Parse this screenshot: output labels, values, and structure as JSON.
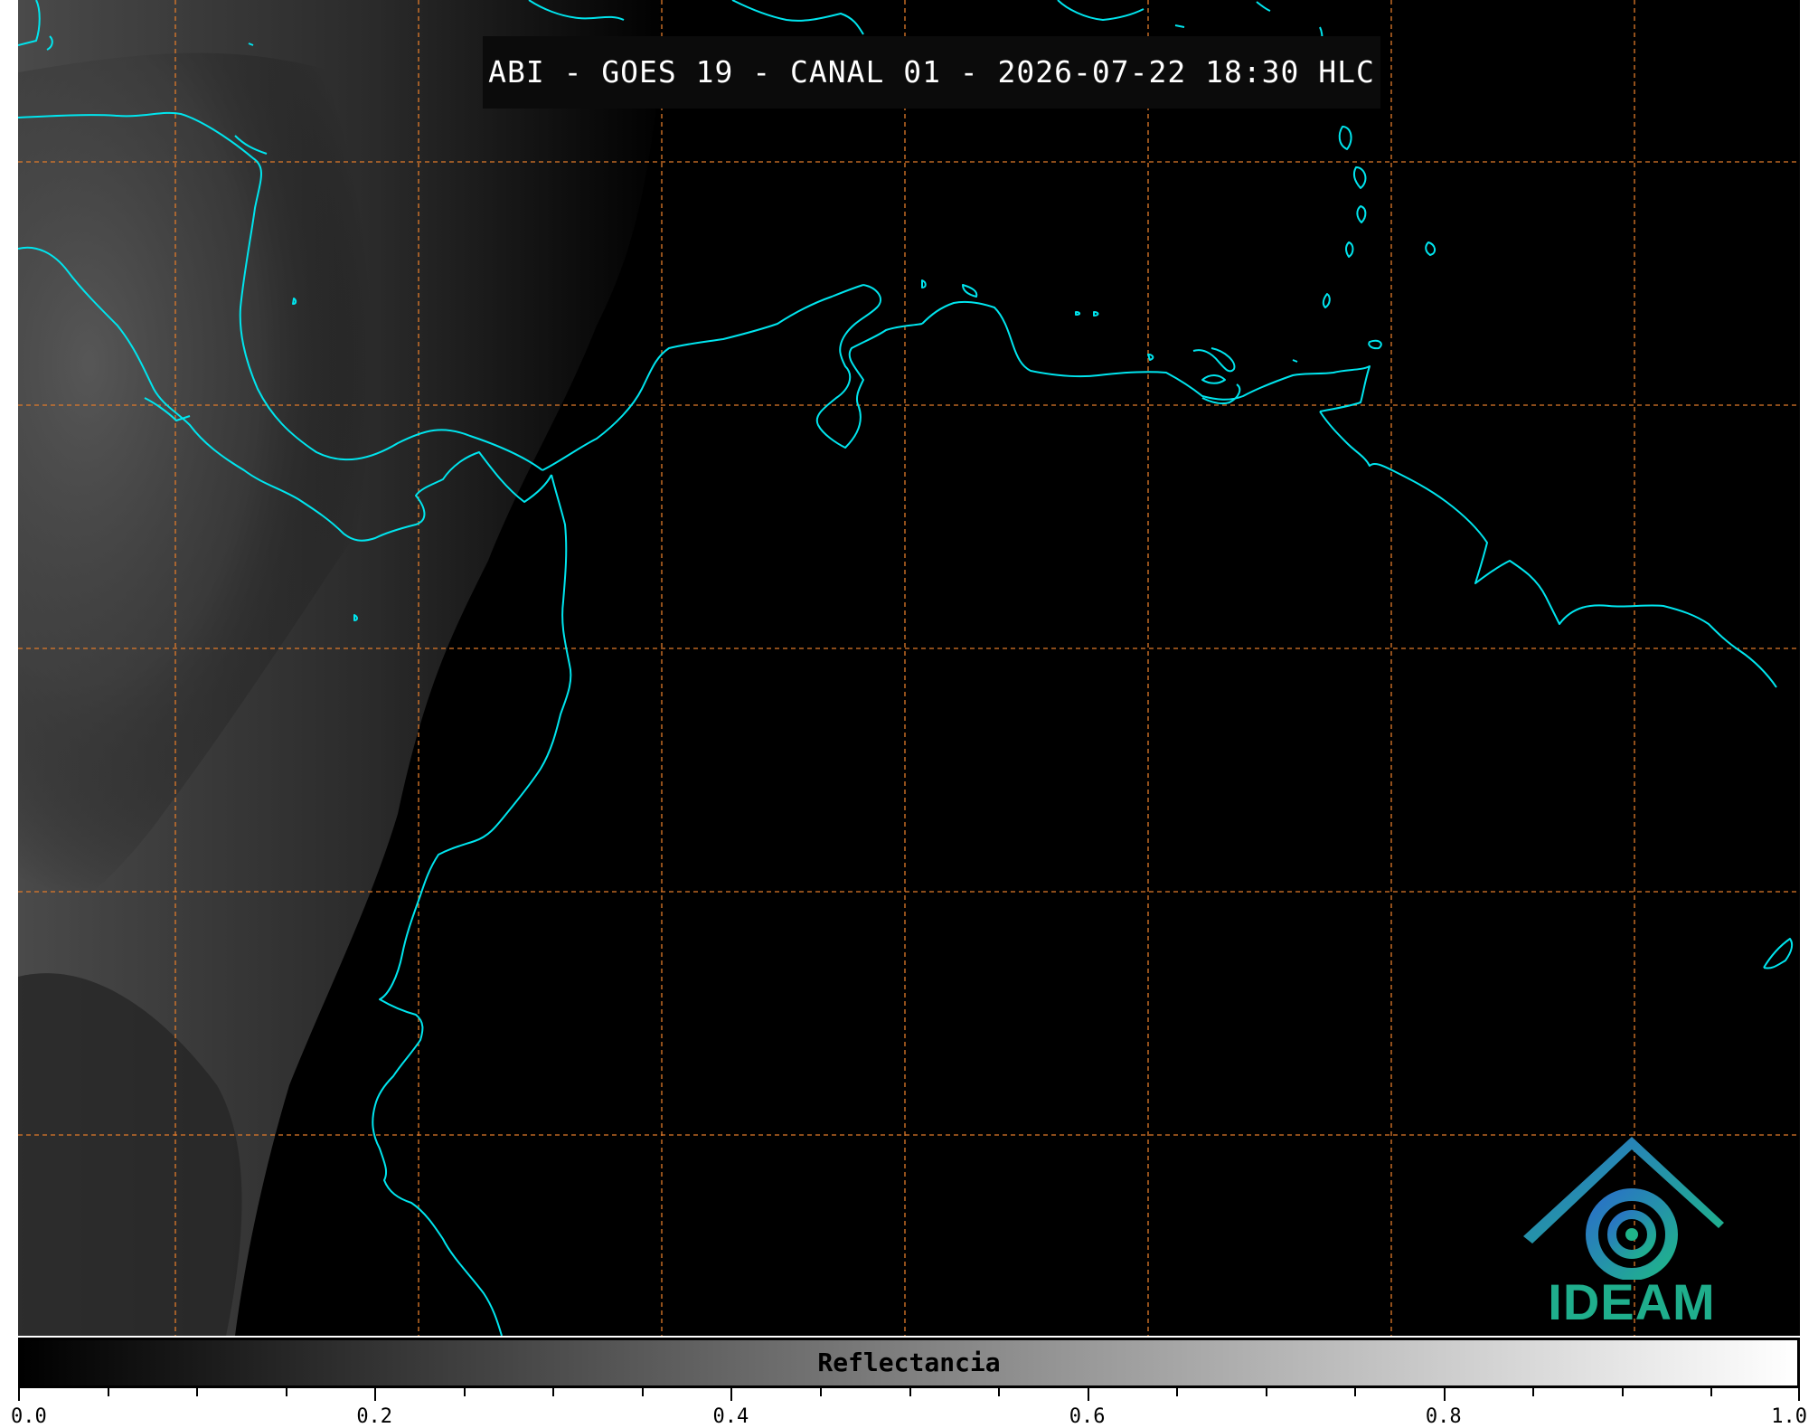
{
  "map": {
    "title": "ABI - GOES 19 - CANAL 01 - 2026-07-22 18:30 HLC",
    "colors": {
      "background": "#000000",
      "coastline": "#00e5ee",
      "grid": "#e07a2a"
    },
    "grid": "on",
    "logo": {
      "text": "IDEAM",
      "icon": "ideam-logo-icon"
    }
  },
  "colorbar": {
    "label": "Reflectancia",
    "range": [
      0.0,
      1.0
    ],
    "ticks": [
      "0.0",
      "0.2",
      "0.4",
      "0.6",
      "0.8",
      "1.0"
    ]
  }
}
